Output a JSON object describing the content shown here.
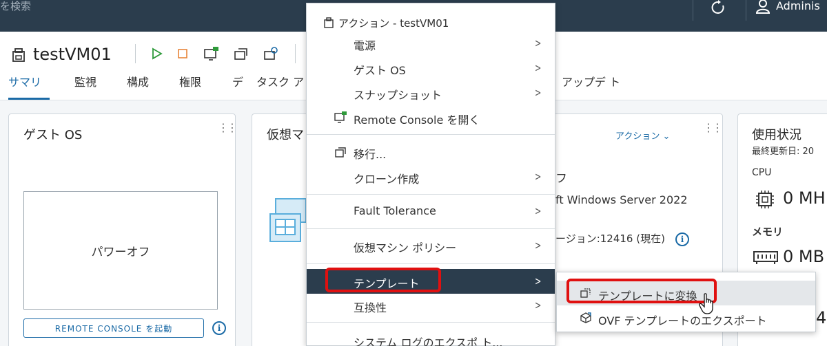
{
  "topbar": {
    "search_partial": "を検索",
    "user_partial": "Adminis"
  },
  "header": {
    "vm_name": "testVM01",
    "tabs": [
      {
        "label": "サマリ",
        "active": true
      },
      {
        "label": "監視"
      },
      {
        "label": "構成"
      },
      {
        "label": "権限"
      },
      {
        "label": "デ"
      },
      {
        "label": "タスク ア"
      },
      {
        "label": "アップデ ト"
      }
    ]
  },
  "guest_card": {
    "title": "ゲスト OS",
    "power_state": "パワーオフ",
    "remote_button": "REMOTE CONSOLE を起動"
  },
  "vm_card": {
    "title_partial": "仮想マ",
    "actions_label": "アクション ⌄",
    "power_partial": "フ",
    "os_partial": "ft Windows Server 2022",
    "version_partial": "ージョン:12416 (現在)"
  },
  "usage_card": {
    "title": "使用状況",
    "updated_partial": "最終更新日: 20",
    "cpu_label": "CPU",
    "cpu_value": "0 MH",
    "mem_label": "メモリ",
    "mem_value": "0 MB",
    "storage_partial": "4"
  },
  "context_menu": {
    "header": "アクション - testVM01",
    "items": [
      {
        "label": "電源",
        "submenu": true
      },
      {
        "label": "ゲスト OS",
        "submenu": true
      },
      {
        "label": "スナップショット",
        "submenu": true
      },
      {
        "label": "Remote Console を開く",
        "submenu": false,
        "icon": "remote-console-icon"
      },
      {
        "label": "移行...",
        "submenu": false,
        "icon": "migrate-icon"
      },
      {
        "label": "クローン作成",
        "submenu": true
      },
      {
        "label": "Fault Tolerance",
        "submenu": true
      },
      {
        "label": "仮想マシン ポリシー",
        "submenu": true
      },
      {
        "label": "テンプレート",
        "submenu": true,
        "highlighted": true
      },
      {
        "label": "互換性",
        "submenu": true
      },
      {
        "label": "システム ログのエクスポ ト...",
        "submenu": false
      }
    ]
  },
  "template_submenu": {
    "items": [
      {
        "label": "テンプレートに変換",
        "icon": "convert-template-icon",
        "hovered": true
      },
      {
        "label": "OVF テンプレートのエクスポート",
        "icon": "export-ovf-icon"
      }
    ]
  },
  "colors": {
    "topbar_bg": "#2b3d4d",
    "accent_blue": "#1a6aa6",
    "play_green": "#2e9a3a",
    "stop_orange": "#e8853a",
    "highlight_bg": "#2b3d4d",
    "annotation_red": "#e01010"
  }
}
